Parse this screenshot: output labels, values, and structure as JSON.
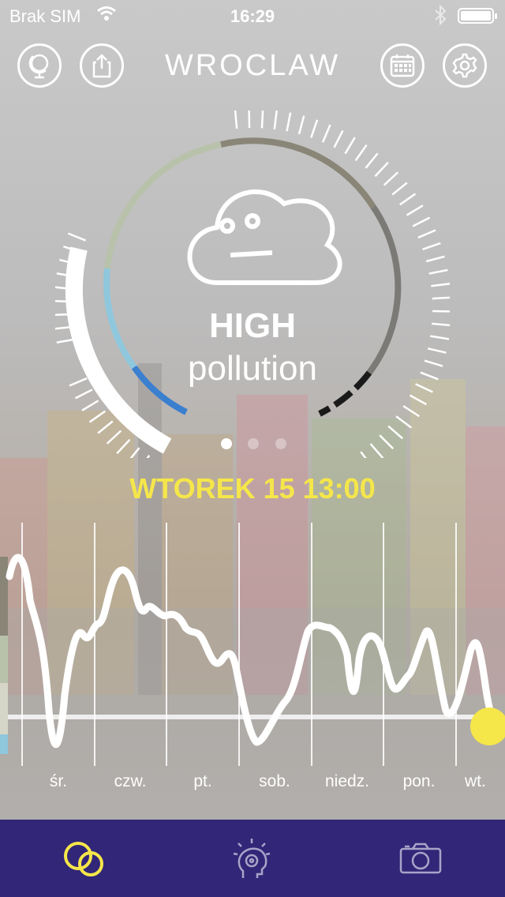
{
  "status_bar": {
    "carrier": "Brak SIM",
    "time": "16:29"
  },
  "header": {
    "city": "WROCLAW",
    "icons": [
      "globe-icon",
      "share-icon",
      "calendar-icon",
      "settings-icon"
    ]
  },
  "gauge": {
    "level": "HIGH",
    "level_sub": "pollution",
    "face_icon": "cloud-face-icon",
    "page_count": 3,
    "active_page": 0
  },
  "forecast": {
    "datetime": "WTOREK 15 13:00",
    "days": [
      "śr.",
      "czw.",
      "pt.",
      "sob.",
      "niedz.",
      "pon.",
      "wt."
    ]
  },
  "tabbar": {
    "tabs": [
      "air-quality-icon",
      "advice-icon",
      "camera-icon"
    ],
    "active_tab": 0
  },
  "colors": {
    "tabbar_bg": "#322678",
    "highlight_yellow": "#f5e64a",
    "low_blue": "#3b7fcf",
    "very_high_black": "#1a1a1a"
  }
}
